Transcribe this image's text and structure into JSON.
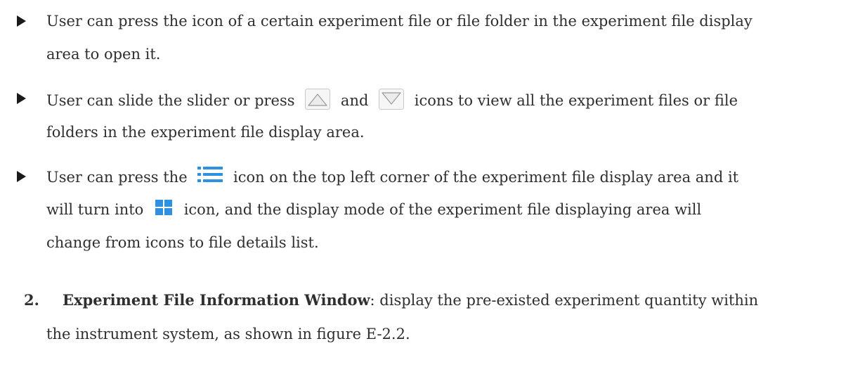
{
  "bullets": [
    {
      "lines": [
        "User can press the icon of a certain experiment file or file folder in the experiment file display",
        "area to open it."
      ]
    },
    {
      "line1": {
        "part1": "User can slide the slider or press",
        "part2": "and",
        "part3": "icons to view all the experiment files or file"
      },
      "line2": "folders in the experiment file display area."
    },
    {
      "line1": {
        "part1": "User can press the",
        "part2": "icon on the top left corner of the experiment file display area and it"
      },
      "line2": {
        "part1": "will turn into",
        "part2": "icon, and the display mode of the experiment file displaying area will"
      },
      "line3": "change from icons to file details list."
    }
  ],
  "section": {
    "number": "2.",
    "title": "Experiment File Information Window",
    "text_line1": ": display the pre-existed experiment quantity within",
    "text_line2": "the instrument system, as shown in figure E-2.2."
  },
  "icons": {
    "up": "triangle-up-icon",
    "down": "triangle-down-icon",
    "list": "list-view-icon",
    "grid": "grid-view-icon"
  },
  "colors": {
    "text": "#2f2f2f",
    "bullet": "#1a1a1a",
    "icon_blue": "#2f8fe0",
    "icon_outline": "#9a9a9a"
  }
}
